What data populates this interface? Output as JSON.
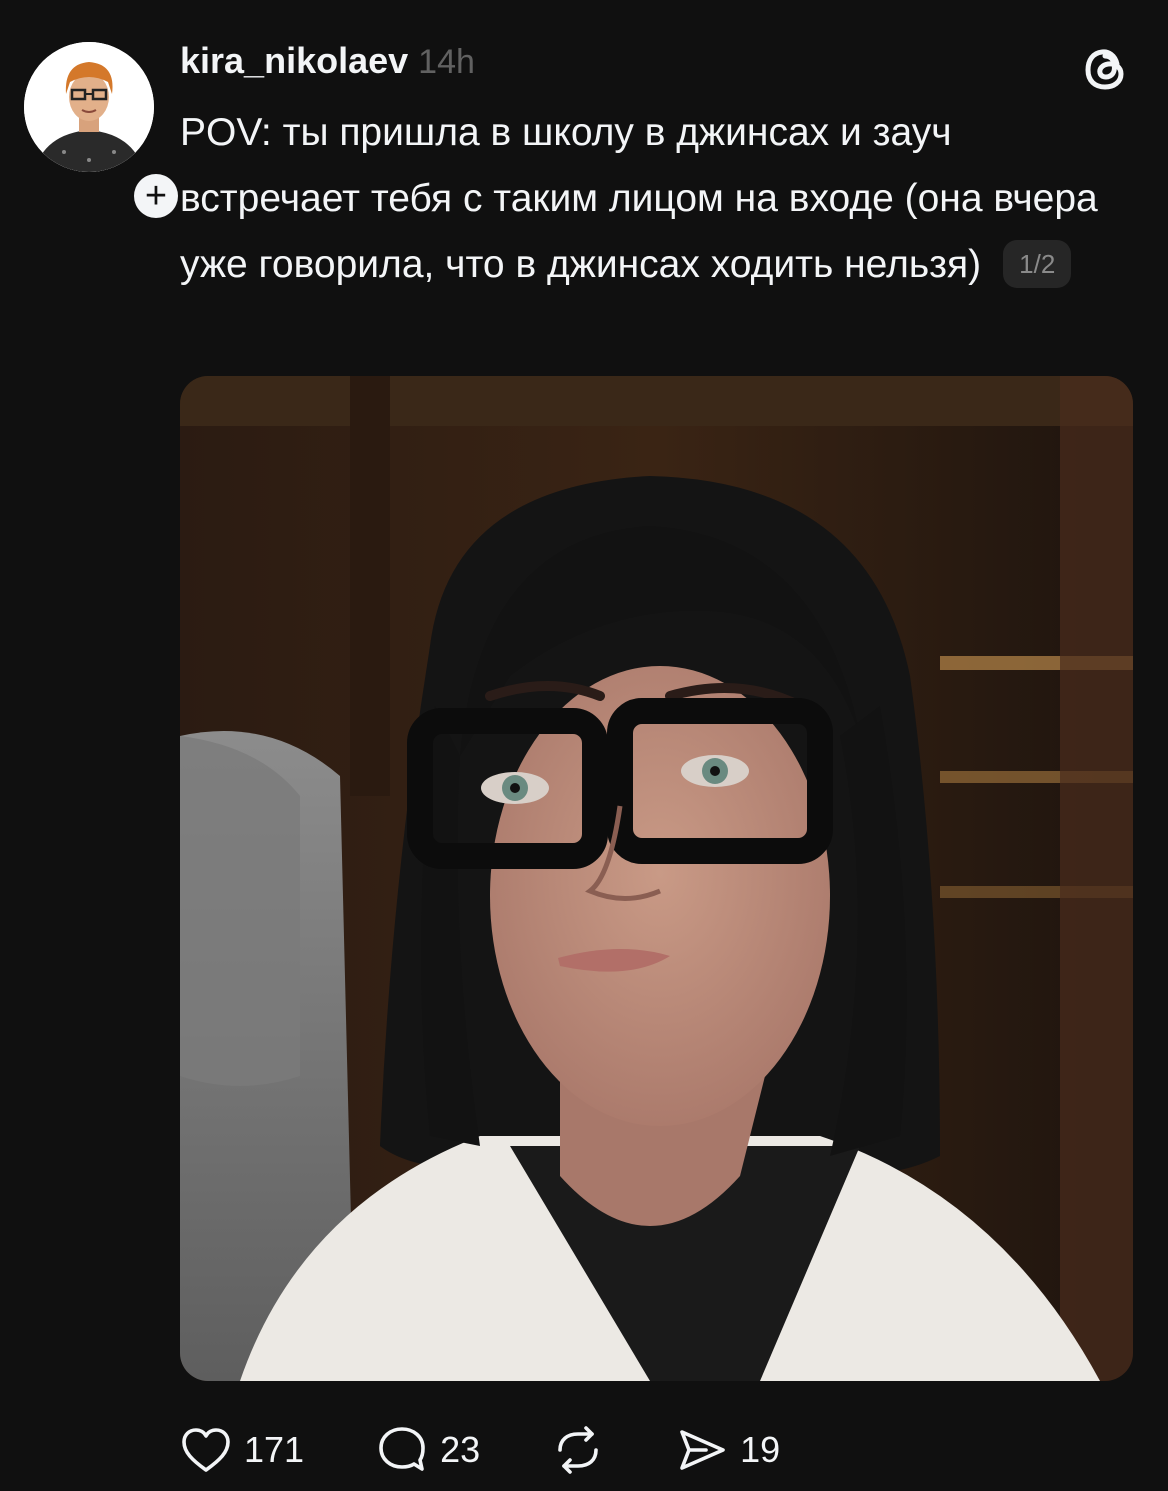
{
  "post": {
    "username": "kira_nikolaev",
    "timestamp": "14h",
    "caption": "POV: ты пришла в школу в джинсах и зауч встречает тебя с таким лицом на входе (она вчера уже говорила, что в джинсах ходить нельзя)",
    "page_indicator": "1/2",
    "follow_icon": "plus-icon",
    "app_icon": "threads-logo-icon",
    "media_description_icon": "photo"
  },
  "actions": {
    "like": {
      "icon": "heart-icon",
      "count": "171"
    },
    "comment": {
      "icon": "comment-bubble-icon",
      "count": "23"
    },
    "repost": {
      "icon": "repost-icon",
      "count": ""
    },
    "share": {
      "icon": "send-icon",
      "count": "19"
    }
  },
  "colors": {
    "background": "#101010",
    "text_primary": "#f3f5f7",
    "text_secondary": "#616161",
    "pill_bg": "#262626"
  }
}
